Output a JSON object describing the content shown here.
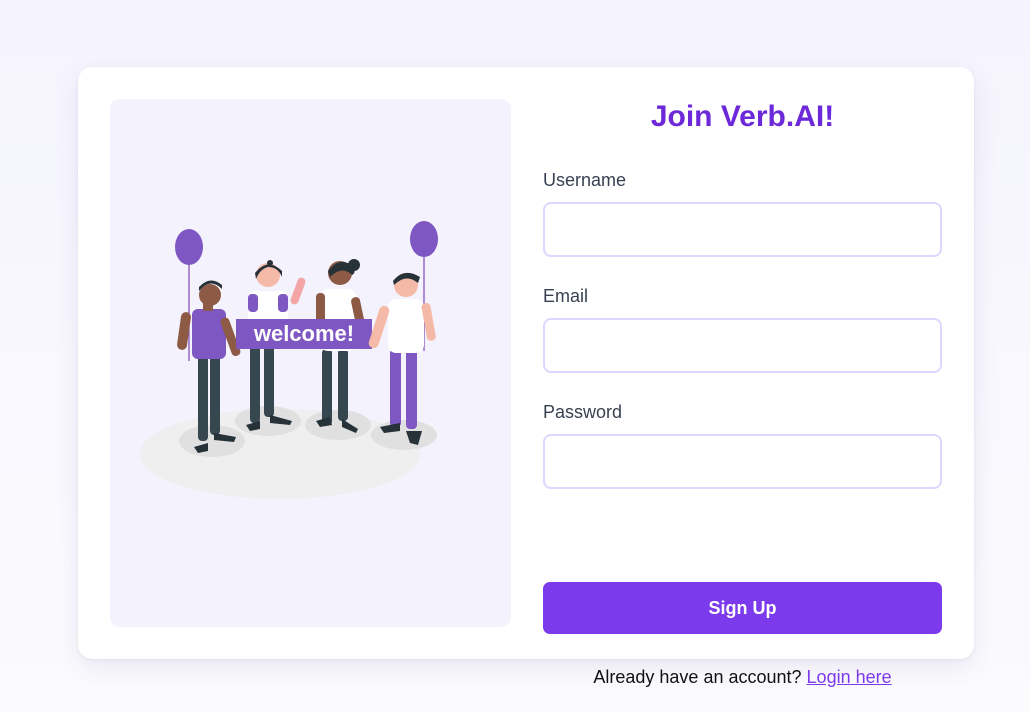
{
  "form": {
    "title": "Join Verb.AI!",
    "fields": [
      {
        "label": "Username",
        "value": "",
        "type": "text"
      },
      {
        "label": "Email",
        "value": "",
        "type": "email"
      },
      {
        "label": "Password",
        "value": "",
        "type": "password"
      }
    ],
    "submit_label": "Sign Up",
    "login_prompt": "Already have an account?",
    "login_link_label": "Login here"
  },
  "illustration": {
    "banner_text": "welcome!",
    "icon": "welcome-group-illustration"
  },
  "colors": {
    "accent": "#7c3aed",
    "title": "#6d28d9",
    "panel_bg": "#f4f2fd",
    "input_border": "#ddd6fe"
  }
}
